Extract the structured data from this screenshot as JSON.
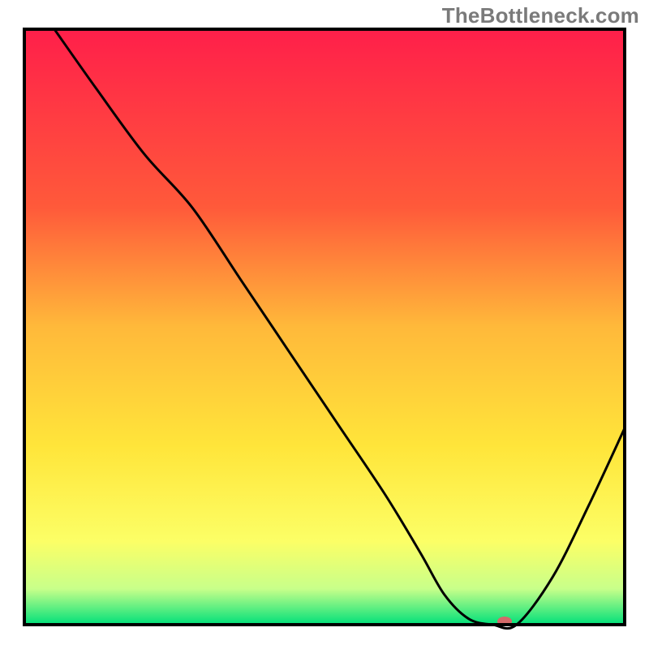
{
  "watermark": "TheBottleneck.com",
  "chart_data": {
    "type": "line",
    "title": "",
    "xlabel": "",
    "ylabel": "",
    "xlim": [
      0,
      100
    ],
    "ylim": [
      0,
      100
    ],
    "gradient_stops": [
      {
        "offset": 0.0,
        "color": "#ff1f4a"
      },
      {
        "offset": 0.3,
        "color": "#ff5a3a"
      },
      {
        "offset": 0.5,
        "color": "#ffb93a"
      },
      {
        "offset": 0.7,
        "color": "#ffe53a"
      },
      {
        "offset": 0.86,
        "color": "#fcff66"
      },
      {
        "offset": 0.94,
        "color": "#c8ff8a"
      },
      {
        "offset": 1.0,
        "color": "#00e07a"
      }
    ],
    "series": [
      {
        "name": "bottleneck-curve",
        "x": [
          5,
          12,
          20,
          28,
          36,
          44,
          52,
          60,
          66,
          70,
          74,
          78,
          82,
          88,
          94,
          100
        ],
        "y": [
          100,
          90,
          79,
          70,
          58,
          46,
          34,
          22,
          12,
          5,
          1,
          0,
          0,
          8,
          20,
          33
        ]
      }
    ],
    "marker": {
      "x": 80,
      "y": 0,
      "color": "#d46a6a",
      "rx": 9,
      "ry": 6
    }
  }
}
